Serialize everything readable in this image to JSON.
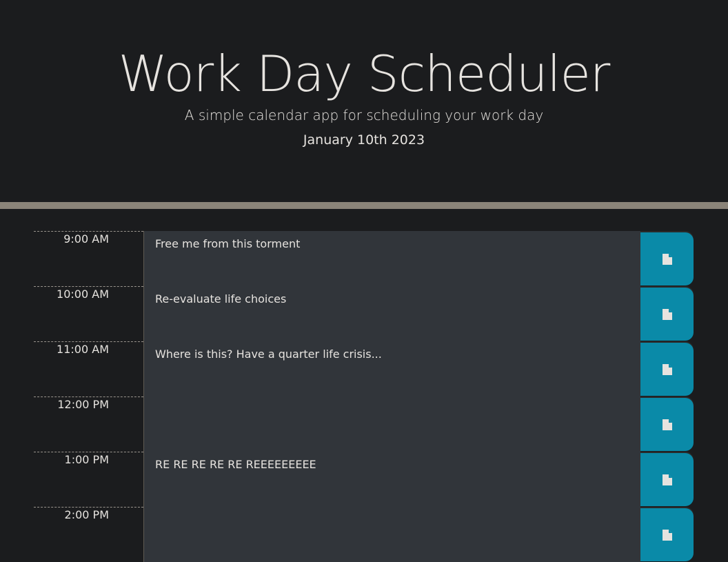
{
  "header": {
    "title": "Work Day Scheduler",
    "subtitle": "A simple calendar app for scheduling your work day",
    "current_day": "January 10th 2023"
  },
  "colors": {
    "background": "#1b1c1e",
    "divider": "#8b8479",
    "textarea": "#31353a",
    "save_button": "#0a8aa8"
  },
  "schedule": [
    {
      "hour": "9:00 AM",
      "description": "Free me from this torment",
      "save_icon": "save-icon"
    },
    {
      "hour": "10:00 AM",
      "description": "Re-evaluate life choices",
      "save_icon": "save-icon"
    },
    {
      "hour": "11:00 AM",
      "description": "Where is this? Have a quarter life crisis...",
      "save_icon": "save-icon"
    },
    {
      "hour": "12:00 PM",
      "description": "",
      "save_icon": "save-icon"
    },
    {
      "hour": "1:00 PM",
      "description": "RE RE RE RE RE REEEEEEEEE",
      "save_icon": "save-icon"
    },
    {
      "hour": "2:00 PM",
      "description": "",
      "save_icon": "save-icon"
    }
  ]
}
